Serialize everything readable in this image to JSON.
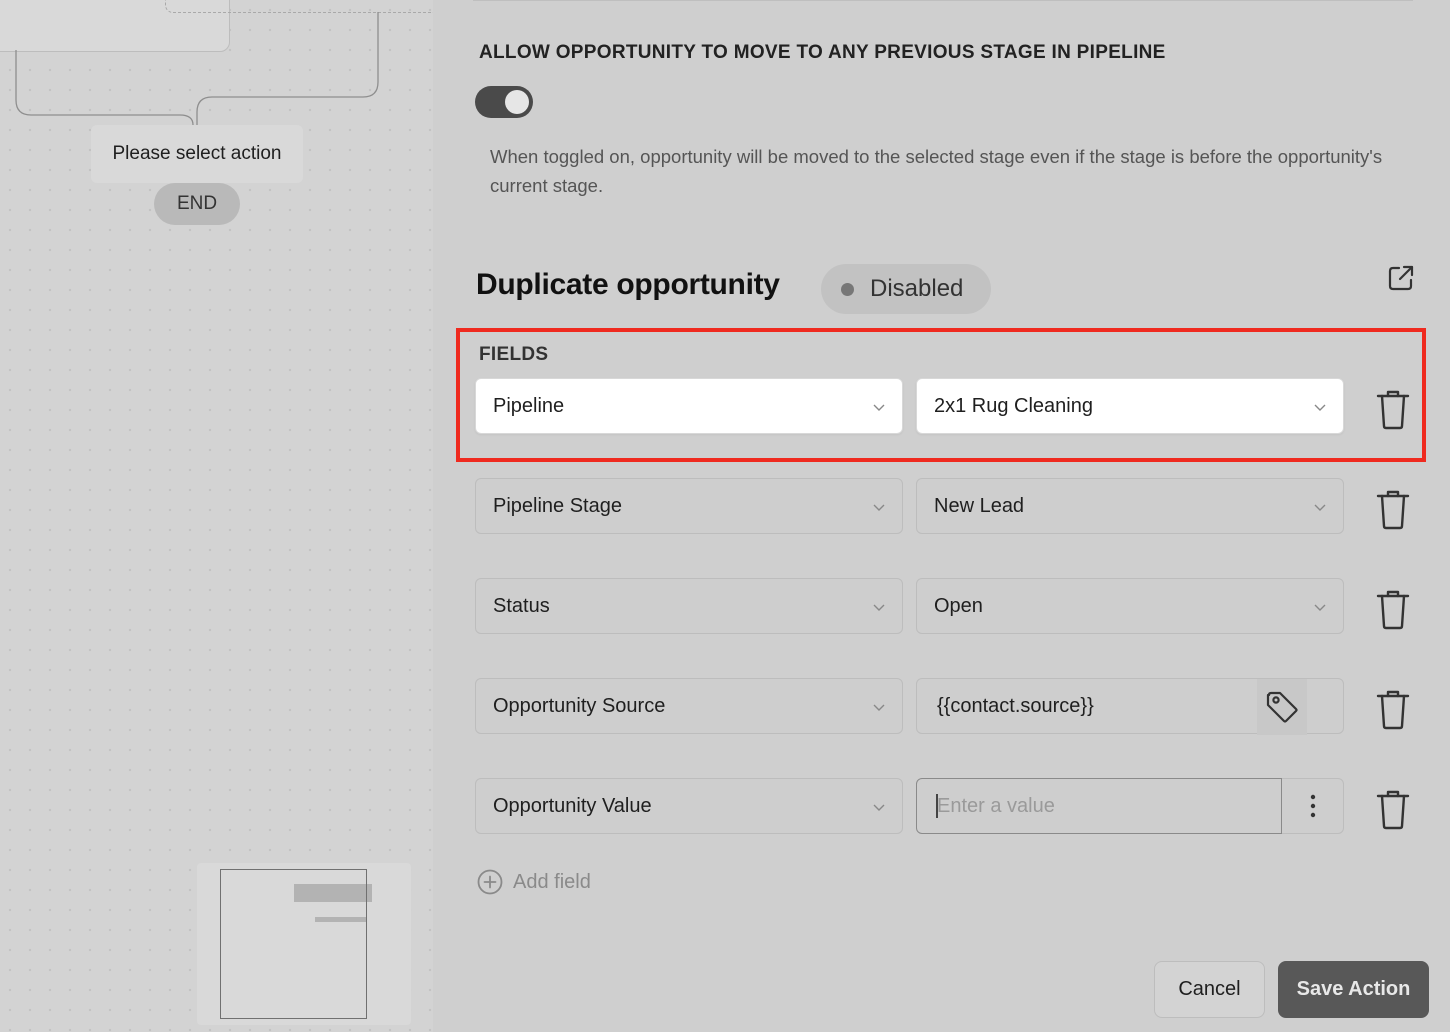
{
  "canvas": {
    "action_node_label": "Please select action",
    "end_node_label": "END"
  },
  "settings": {
    "allow_previous_stage": {
      "label": "ALLOW OPPORTUNITY TO MOVE TO ANY PREVIOUS STAGE IN PIPELINE",
      "enabled": true,
      "help_text": "When toggled on, opportunity will be moved to the selected stage even if the stage is before the opportunity's current stage."
    }
  },
  "section": {
    "title": "Duplicate opportunity",
    "status_badge": "Disabled",
    "link_icon": "external-link-icon"
  },
  "fields": {
    "label": "FIELDS",
    "rows": [
      {
        "field": "Pipeline",
        "value": "2x1 Rug Cleaning"
      },
      {
        "field": "Pipeline Stage",
        "value": "New Lead"
      },
      {
        "field": "Status",
        "value": "Open"
      },
      {
        "field": "Opportunity Source",
        "value": "{{contact.source}}"
      },
      {
        "field": "Opportunity Value",
        "value": "",
        "placeholder": "Enter a value"
      }
    ],
    "add_label": "Add field"
  },
  "footer": {
    "cancel_label": "Cancel",
    "save_label": "Save Action"
  },
  "colors": {
    "highlight": "#ef2a1f",
    "primary_button": "#585858",
    "toggle_on": "#4a4a4a"
  }
}
